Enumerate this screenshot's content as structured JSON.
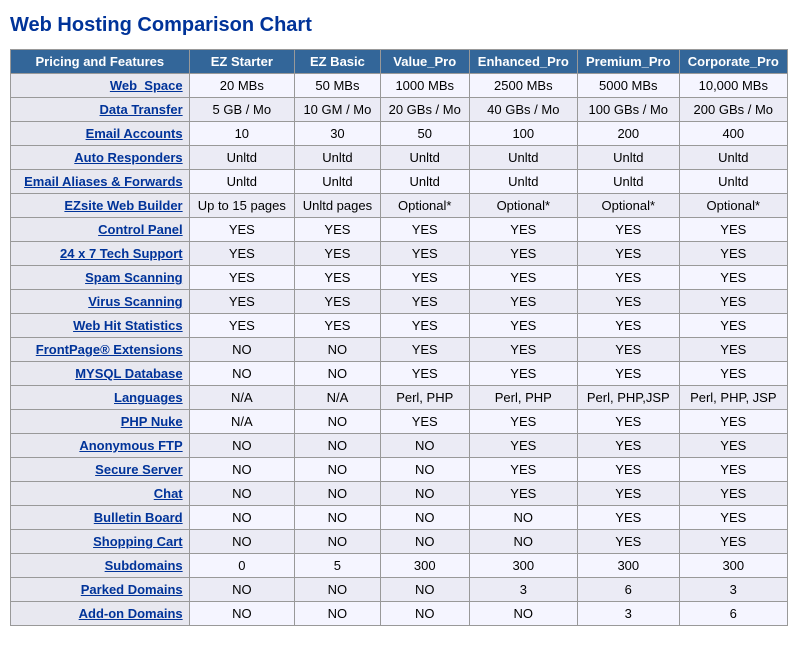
{
  "title": "Web Hosting Comparison Chart",
  "columns": [
    "Pricing and Features",
    "EZ Starter",
    "EZ Basic",
    "Value_Pro",
    "Enhanced_Pro",
    "Premium_Pro",
    "Corporate_Pro"
  ],
  "rows": [
    {
      "feature": "Web_Space",
      "values": [
        "20 MBs",
        "50 MBs",
        "1000 MBs",
        "2500 MBs",
        "5000 MBs",
        "10,000 MBs"
      ]
    },
    {
      "feature": "Data Transfer",
      "values": [
        "5 GB / Mo",
        "10 GM / Mo",
        "20 GBs / Mo",
        "40 GBs / Mo",
        "100 GBs / Mo",
        "200 GBs / Mo"
      ]
    },
    {
      "feature": "Email Accounts",
      "values": [
        "10",
        "30",
        "50",
        "100",
        "200",
        "400"
      ]
    },
    {
      "feature": "Auto Responders",
      "values": [
        "Unltd",
        "Unltd",
        "Unltd",
        "Unltd",
        "Unltd",
        "Unltd"
      ]
    },
    {
      "feature": "Email Aliases & Forwards",
      "values": [
        "Unltd",
        "Unltd",
        "Unltd",
        "Unltd",
        "Unltd",
        "Unltd"
      ]
    },
    {
      "feature": "EZsite Web Builder",
      "values": [
        "Up to 15 pages",
        "Unltd pages",
        "Optional*",
        "Optional*",
        "Optional*",
        "Optional*"
      ]
    },
    {
      "feature": "Control Panel",
      "values": [
        "YES",
        "YES",
        "YES",
        "YES",
        "YES",
        "YES"
      ]
    },
    {
      "feature": "24 x 7 Tech Support",
      "values": [
        "YES",
        "YES",
        "YES",
        "YES",
        "YES",
        "YES"
      ]
    },
    {
      "feature": "Spam Scanning",
      "values": [
        "YES",
        "YES",
        "YES",
        "YES",
        "YES",
        "YES"
      ]
    },
    {
      "feature": "Virus Scanning",
      "values": [
        "YES",
        "YES",
        "YES",
        "YES",
        "YES",
        "YES"
      ]
    },
    {
      "feature": "Web Hit Statistics",
      "values": [
        "YES",
        "YES",
        "YES",
        "YES",
        "YES",
        "YES"
      ]
    },
    {
      "feature": "FrontPage® Extensions",
      "values": [
        "NO",
        "NO",
        "YES",
        "YES",
        "YES",
        "YES"
      ]
    },
    {
      "feature": "MYSQL Database",
      "values": [
        "NO",
        "NO",
        "YES",
        "YES",
        "YES",
        "YES"
      ]
    },
    {
      "feature": "Languages",
      "values": [
        "N/A",
        "N/A",
        "Perl, PHP",
        "Perl, PHP",
        "Perl, PHP,JSP",
        "Perl, PHP, JSP"
      ]
    },
    {
      "feature": "PHP Nuke",
      "values": [
        "N/A",
        "NO",
        "YES",
        "YES",
        "YES",
        "YES"
      ]
    },
    {
      "feature": "Anonymous FTP",
      "values": [
        "NO",
        "NO",
        "NO",
        "YES",
        "YES",
        "YES"
      ]
    },
    {
      "feature": "Secure Server",
      "values": [
        "NO",
        "NO",
        "NO",
        "YES",
        "YES",
        "YES"
      ]
    },
    {
      "feature": "Chat",
      "values": [
        "NO",
        "NO",
        "NO",
        "YES",
        "YES",
        "YES"
      ]
    },
    {
      "feature": "Bulletin Board",
      "values": [
        "NO",
        "NO",
        "NO",
        "NO",
        "YES",
        "YES"
      ]
    },
    {
      "feature": "Shopping Cart",
      "values": [
        "NO",
        "NO",
        "NO",
        "NO",
        "YES",
        "YES"
      ]
    },
    {
      "feature": "Subdomains",
      "values": [
        "0",
        "5",
        "300",
        "300",
        "300",
        "300"
      ]
    },
    {
      "feature": "Parked Domains",
      "values": [
        "NO",
        "NO",
        "NO",
        "3",
        "6",
        "3"
      ]
    },
    {
      "feature": "Add-on Domains",
      "values": [
        "NO",
        "NO",
        "NO",
        "NO",
        "3",
        "6"
      ]
    }
  ]
}
